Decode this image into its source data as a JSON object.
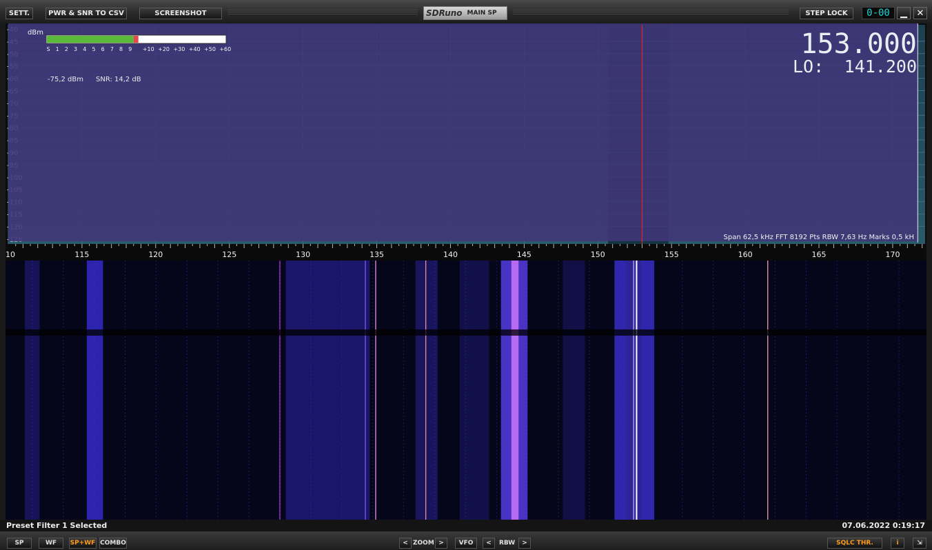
{
  "app": {
    "brand": "SDRuno",
    "window": "MAIN SP"
  },
  "toolbar": {
    "settings": "SETT.",
    "export_csv": "PWR & SNR TO CSV",
    "screenshot": "SCREENSHOT",
    "step_lock": "STEP LOCK",
    "step_display": "0-00",
    "minimize": "▁",
    "close": "✕"
  },
  "spectrum": {
    "y_unit": "dBm",
    "y_ticks": [
      "-40",
      "-45",
      "-50",
      "-55",
      "-60",
      "-65",
      "-70",
      "-75",
      "-80",
      "-85",
      "-90",
      "-95",
      "-100",
      "-105",
      "-110",
      "-115",
      "-120",
      "-126"
    ],
    "x_ticks": [
      "10",
      "115",
      "120",
      "125",
      "130",
      "135",
      "140",
      "145",
      "150",
      "155",
      "160",
      "165",
      "170"
    ],
    "smeter_labels": [
      "S",
      "1",
      "2",
      "3",
      "4",
      "5",
      "6",
      "7",
      "8",
      "9",
      "+10",
      "+20",
      "+30",
      "+40",
      "+50",
      "+60"
    ],
    "smeter_level": 0.52,
    "power_readout": "-75,2 dBm",
    "snr_readout": "SNR: 14,2 dB",
    "frequency": "153.000",
    "lo_label": "LO:",
    "lo_value": "141.200",
    "info_line": "Span 62,5 kHz   FFT 8192 Pts   RBW 7,63 Hz   Marks 0,5 kH"
  },
  "status": {
    "message": "Preset Filter 1 Selected",
    "datetime": "07.06.2022 0:19:17"
  },
  "bottom": {
    "sp": "SP",
    "wf": "WF",
    "spwf": "SP+WF",
    "combo": "COMBO",
    "zoom_left": "<",
    "zoom": "ZOOM",
    "zoom_right": ">",
    "vfo": "VFO",
    "rbw_left": "<",
    "rbw": "RBW",
    "rbw_right": ">",
    "sqlc": "SQLC THR.",
    "info": "i",
    "resize": "⇲"
  },
  "colors": {
    "accent": "#ff9a1a",
    "lcd": "#19d6d6",
    "tuning": "#ff2020",
    "spectrum_bg": "#1f4656",
    "fill": "#5a4f96"
  }
}
